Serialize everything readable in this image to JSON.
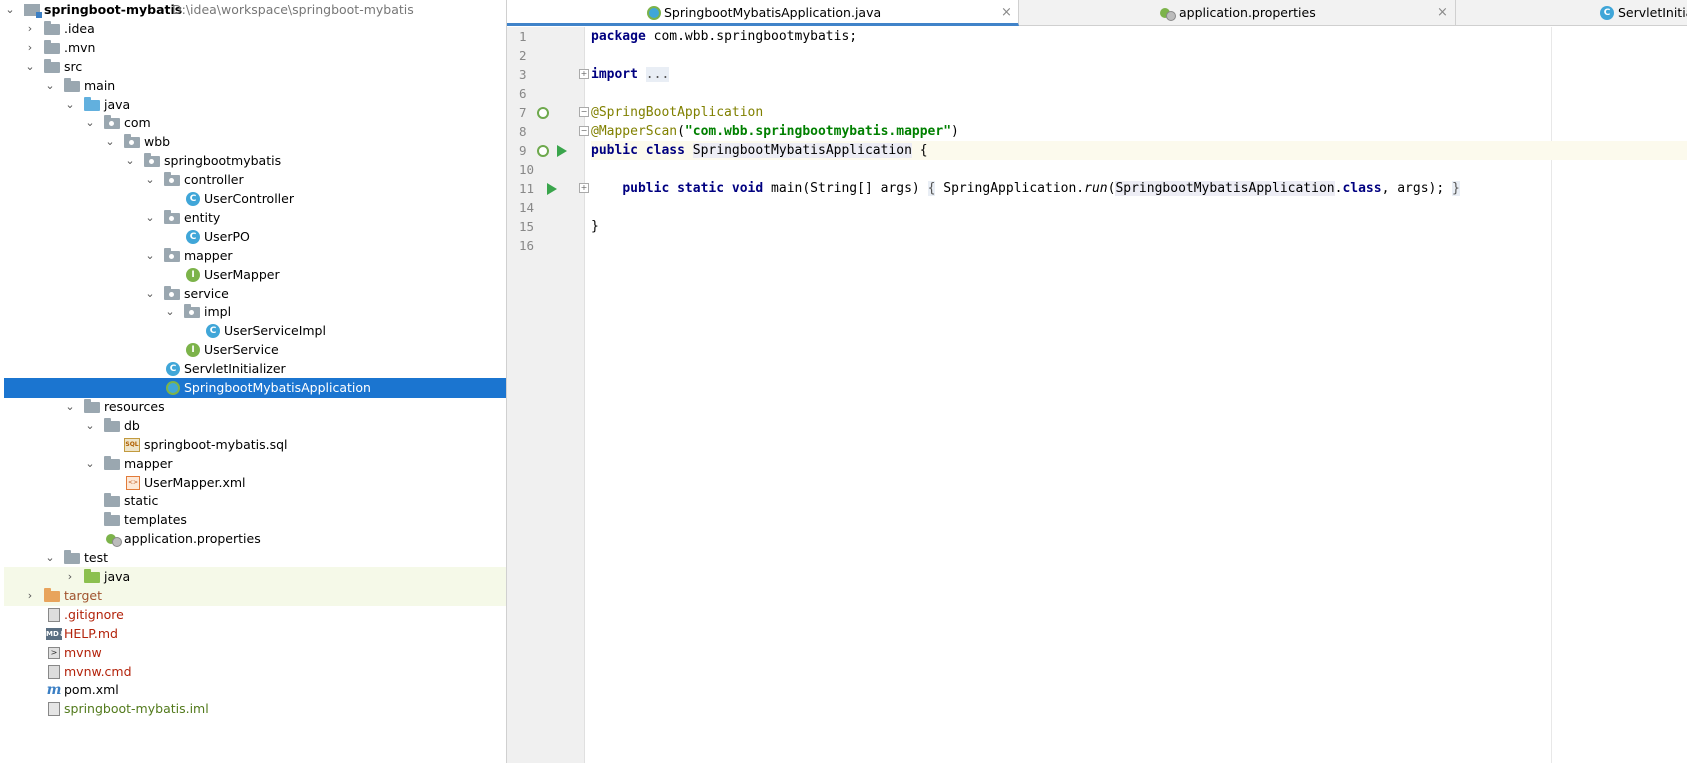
{
  "project_tree": {
    "root": {
      "label": "springboot-mybatis",
      "path": "D:\\idea\\workspace\\springboot-mybatis"
    },
    "items": [
      {
        "label": ".idea"
      },
      {
        "label": ".mvn"
      },
      {
        "label": "src"
      },
      {
        "label": "main"
      },
      {
        "label": "java"
      },
      {
        "label": "com"
      },
      {
        "label": "wbb"
      },
      {
        "label": "springbootmybatis"
      },
      {
        "label": "controller"
      },
      {
        "label": "UserController"
      },
      {
        "label": "entity"
      },
      {
        "label": "UserPO"
      },
      {
        "label": "mapper"
      },
      {
        "label": "UserMapper"
      },
      {
        "label": "service"
      },
      {
        "label": "impl"
      },
      {
        "label": "UserServiceImpl"
      },
      {
        "label": "UserService"
      },
      {
        "label": "ServletInitializer"
      },
      {
        "label": "SpringbootMybatisApplication"
      },
      {
        "label": "resources"
      },
      {
        "label": "db"
      },
      {
        "label": "springboot-mybatis.sql"
      },
      {
        "label": "mapper"
      },
      {
        "label": "UserMapper.xml"
      },
      {
        "label": "static"
      },
      {
        "label": "templates"
      },
      {
        "label": "application.properties"
      },
      {
        "label": "test"
      },
      {
        "label": "java"
      },
      {
        "label": "target"
      },
      {
        "label": ".gitignore"
      },
      {
        "label": "HELP.md"
      },
      {
        "label": "mvnw"
      },
      {
        "label": "mvnw.cmd"
      },
      {
        "label": "pom.xml"
      },
      {
        "label": "springboot-mybatis.iml"
      }
    ]
  },
  "icons": {
    "class_letter": "C",
    "interface_letter": "I",
    "sql_badge": "SQL",
    "xml_badge": "<>",
    "md_badge": "MD↓",
    "term_badge": ">",
    "maven_badge": "m"
  },
  "tabs": [
    {
      "label": "SpringbootMybatisApplication.java",
      "close": "×"
    },
    {
      "label": "application.properties",
      "close": "×"
    },
    {
      "label": "ServletInitializ"
    }
  ],
  "editor": {
    "line_numbers": [
      "1",
      "2",
      "3",
      "6",
      "7",
      "8",
      "9",
      "10",
      "11",
      "14",
      "15",
      "16"
    ],
    "fold_plus": "+",
    "fold_minus": "−",
    "code": {
      "l1_kw": "package",
      "l1_rest": " com.wbb.springbootmybatis;",
      "l3_kw": "import",
      "l3_fold": "...",
      "l7_ann": "@SpringBootApplication",
      "l8_ann": "@MapperScan",
      "l8_open": "(",
      "l8_str": "\"com.wbb.springbootmybatis.mapper\"",
      "l8_close": ")",
      "l9_kw1": "public",
      "l9_kw2": "class",
      "l9_name": "SpringbootMybatisApplication",
      "l9_brace": " {",
      "l11_indent": "    ",
      "l11_kw1": "public",
      "l11_kw2": "static",
      "l11_kw3": "void",
      "l11_sig": " main(String[] args) ",
      "l11_fold_open": "{",
      "l11_call": " SpringApplication.",
      "l11_run": "run",
      "l11_paren": "(",
      "l11_ref": "SpringbootMybatisApplication",
      "l11_dot": ".",
      "l11_class": "class",
      "l11_args": ", args); ",
      "l11_fold_close": "}",
      "l15_brace": "}"
    }
  }
}
